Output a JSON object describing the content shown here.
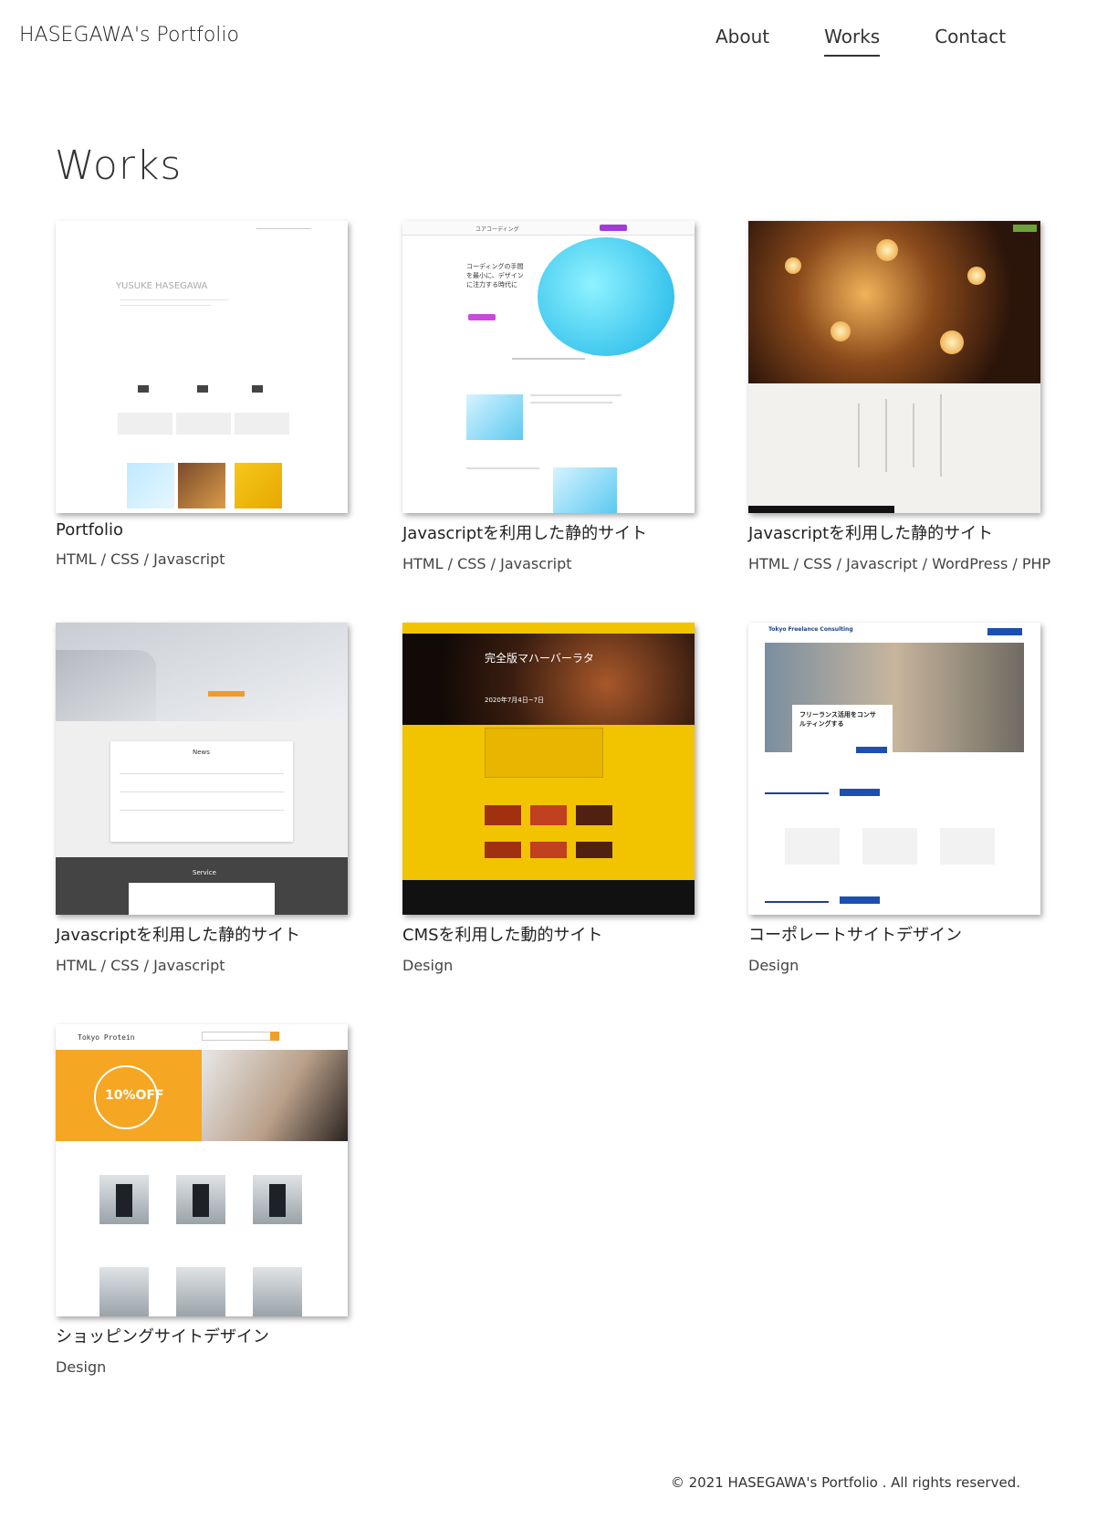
{
  "header": {
    "logo": "HASEGAWA's Portfolio",
    "nav": [
      {
        "label": "About",
        "active": false
      },
      {
        "label": "Works",
        "active": true
      },
      {
        "label": "Contact",
        "active": false
      }
    ]
  },
  "main": {
    "title": "Works",
    "works": [
      {
        "title": "Portfolio",
        "tags": "HTML / CSS / Javascript"
      },
      {
        "title": "Javascriptを利用した静的サイト",
        "tags": "HTML / CSS / Javascript"
      },
      {
        "title": "Javascriptを利用した静的サイト",
        "tags": "HTML / CSS / Javascript / WordPress / PHP"
      },
      {
        "title": "Javascriptを利用した静的サイト",
        "tags": "HTML / CSS / Javascript"
      },
      {
        "title": "CMSを利用した動的サイト",
        "tags": "Design"
      },
      {
        "title": "コーポレートサイトデザイン",
        "tags": "Design"
      },
      {
        "title": "ショッピングサイトデザイン",
        "tags": "Design"
      }
    ],
    "thumb_text": {
      "portfolio_name": "YUSUKE HASEGAWA",
      "coding_name": "ユアコーディング",
      "coding_heading": "コーディングの手間を最小に、デザインに注力する時代に",
      "news_heading": "News",
      "service_heading": "Service",
      "stage_title": "完全版マハーバーラタ",
      "stage_date": "2020年7月4日~7日",
      "corp_name": "Tokyo Freelance Consulting",
      "corp_hero": "フリーランス活用をコンサルティングする",
      "shop_name": "Tokyo Protein",
      "shop_sale": "10%OFF"
    }
  },
  "footer": {
    "copyright": "© 2021 HASEGAWA's Portfolio . All rights reserved."
  }
}
